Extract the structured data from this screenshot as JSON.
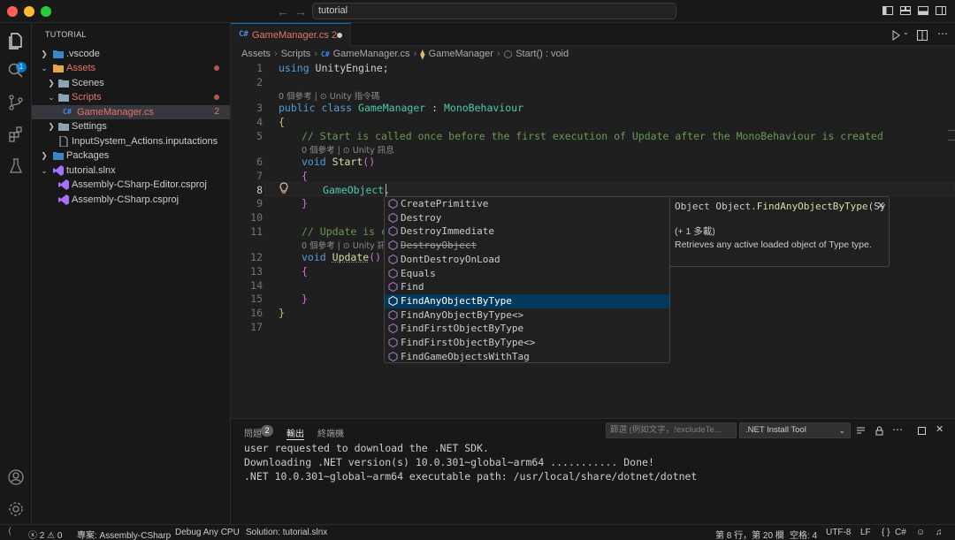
{
  "titlebar": {
    "search_text": "tutorial"
  },
  "activity": {
    "explorer_badge": "1"
  },
  "sidebar": {
    "title": "TUTORIAL",
    "tree": [
      {
        "label": ".vscode",
        "kind": "folder"
      },
      {
        "label": "Assets",
        "kind": "folder"
      },
      {
        "label": "Scenes",
        "kind": "folder"
      },
      {
        "label": "Scripts",
        "kind": "folder"
      },
      {
        "label": "GameManager.cs",
        "kind": "file",
        "count": "2"
      },
      {
        "label": "Settings",
        "kind": "folder"
      },
      {
        "label": "InputSystem_Actions.inputactions",
        "kind": "file"
      },
      {
        "label": "Packages",
        "kind": "folder"
      },
      {
        "label": "tutorial.slnx",
        "kind": "folder"
      },
      {
        "label": "Assembly-CSharp-Editor.csproj",
        "kind": "file"
      },
      {
        "label": "Assembly-CSharp.csproj",
        "kind": "file"
      }
    ]
  },
  "tab": {
    "cs_glyph": "C#",
    "title": "GameManager.cs",
    "problems": "2"
  },
  "breadcrumb": {
    "parts": [
      "Assets",
      "Scripts",
      "GameManager.cs",
      "GameManager",
      "Start() : void"
    ]
  },
  "editor": {
    "line_numbers": [
      "1",
      "2",
      "3",
      "4",
      "5",
      "6",
      "7",
      "8",
      "9",
      "10",
      "11",
      "12",
      "13",
      "14",
      "15",
      "16",
      "17"
    ],
    "lens_class": "0 個參考 | ⊙ Unity 指令碼",
    "lens_start": "0 個參考 | ⊙ Unity 訊息",
    "lens_update": "0 個參考 | ⊙ Unity 訊息",
    "code": {
      "l1_kw": "using",
      "l1_rest": " UnityEngine;",
      "l3_kw": "public class",
      "l3_name": "GameManager",
      "l3_colon": " : ",
      "l3_base": "MonoBehaviour",
      "l4": "{",
      "l5": "// Start is called once before the first execution of Update after the MonoBehaviour is created",
      "l6_kw": "void",
      "l6_fn": "Start",
      "l6_paren": "()",
      "l7": "{",
      "l8": "GameObject.",
      "l9": "}",
      "l11": "// Update is ca",
      "l12_kw": "void",
      "l12_fn": "Update",
      "l12_paren": "()",
      "l13": "{",
      "l15": "}",
      "l16": "}"
    }
  },
  "suggest": {
    "items": [
      "CreatePrimitive",
      "Destroy",
      "DestroyImmediate",
      "DestroyObject",
      "DontDestroyOnLoad",
      "Equals",
      "Find",
      "FindAnyObjectByType",
      "FindAnyObjectByType<>",
      "FindFirstObjectByType",
      "FindFirstObjectByType<>",
      "FindGameObjectsWithTag"
    ],
    "active_index": 7,
    "details": {
      "sig_type": "Object Object.",
      "sig_method": "FindAnyObjectByType",
      "sig_rest": "(Sy",
      "overloads": "(+ 1 多載)",
      "description": "Retrieves any active loaded object of Type type."
    }
  },
  "panel": {
    "tabs": [
      "問題",
      "輸出",
      "終端機"
    ],
    "problems_count": "2",
    "filter_placeholder": "篩選 (例如文字，!excludeTe...",
    "channel": ".NET Install Tool",
    "output": [
      "user requested to download the .NET SDK.",
      "Downloading .NET version(s) 10.0.301~global~arm64 ........... Done!",
      ".NET 10.0.301~global~arm64 executable path: /usr/local/share/dotnet/dotnet"
    ]
  },
  "statusbar": {
    "errors": "2",
    "warnings": "0",
    "project": "專案: Assembly-CSharp",
    "config": "Debug Any CPU",
    "solution": "Solution: tutorial.slnx",
    "position": "第 8 行，第 20 欄",
    "indent": "空格: 4",
    "encoding": "UTF-8",
    "eol": "LF",
    "braces": "{ }",
    "language": "C#"
  }
}
